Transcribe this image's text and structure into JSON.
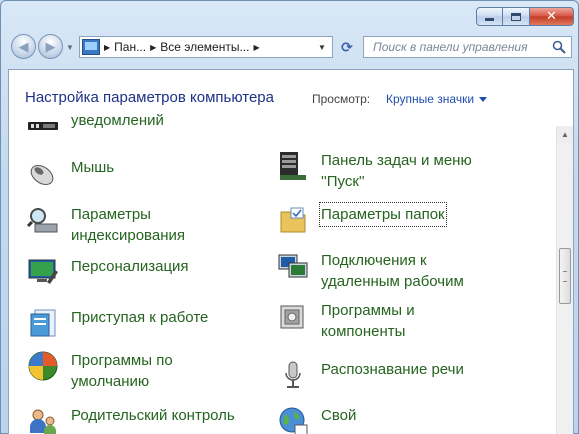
{
  "window": {
    "close_glyph": "✕"
  },
  "nav": {
    "back_glyph": "◀",
    "forward_glyph": "▶",
    "breadcrumbs": [
      "Пан...",
      "Все элементы..."
    ],
    "refresh_glyph": "⟳"
  },
  "search": {
    "placeholder": "Поиск в панели управления"
  },
  "header": {
    "title": "Настройка параметров компьютера",
    "view_label": "Просмотр:",
    "view_value": "Крупные значки"
  },
  "items": [
    {
      "label": "уведомлений",
      "icon": "notification-icon"
    },
    {
      "label": "Мышь",
      "icon": "mouse-icon"
    },
    {
      "label": "Панель задач и меню ''Пуск''",
      "icon": "taskbar-icon"
    },
    {
      "label": "Параметры индексирования",
      "icon": "indexing-icon"
    },
    {
      "label": "Параметры папок",
      "icon": "folder-options-icon"
    },
    {
      "label": "Персонализация",
      "icon": "personalization-icon"
    },
    {
      "label": "Подключения к удаленным рабочим",
      "icon": "remote-desktop-icon"
    },
    {
      "label": "Приступая к работе",
      "icon": "getting-started-icon"
    },
    {
      "label": "Программы и компоненты",
      "icon": "programs-icon"
    },
    {
      "label": "Программы по умолчанию",
      "icon": "default-programs-icon"
    },
    {
      "label": "Распознавание речи",
      "icon": "speech-icon"
    },
    {
      "label": "Родительский контроль",
      "icon": "parental-control-icon"
    },
    {
      "label": "Свой",
      "icon": "globe-icon"
    }
  ],
  "colors": {
    "link_green": "#256420",
    "title_blue": "#1e3287",
    "accent_blue": "#1f4fab"
  }
}
